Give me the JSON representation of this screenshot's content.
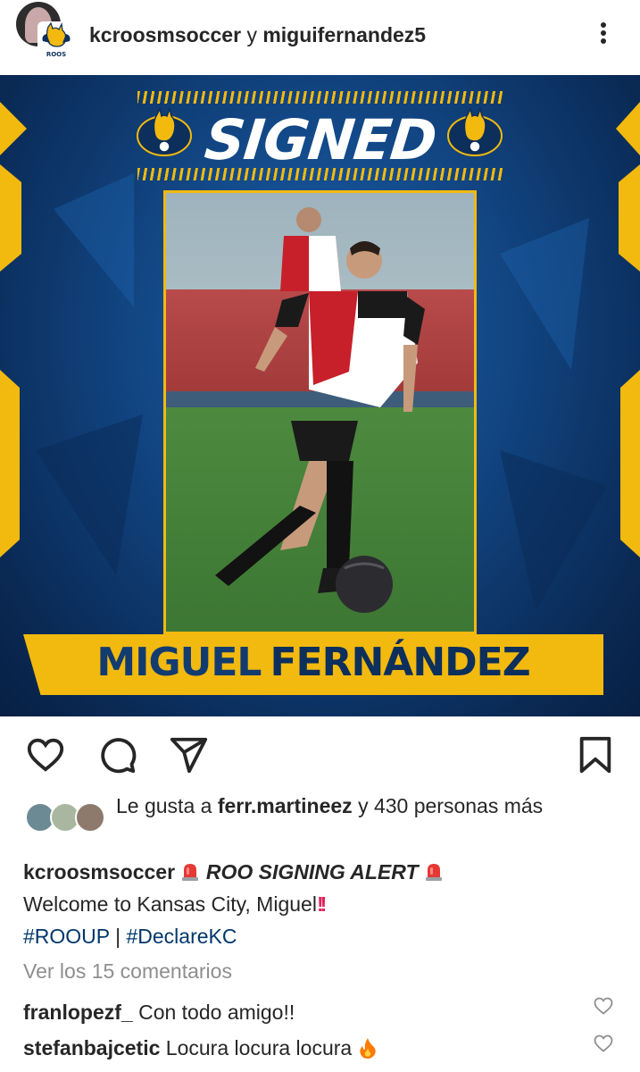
{
  "header": {
    "user1": "kcroosmsoccer",
    "conj": "y",
    "user2": "miguifernandez5",
    "badge_text": "ROOS"
  },
  "post": {
    "headline": "SIGNED",
    "first_name": "MIGUEL",
    "last_name": "FERNÁNDEZ",
    "colors": {
      "accent": "#f2b90f",
      "navy": "#0c2f5c",
      "blue": "#134a8a"
    }
  },
  "actions": {
    "icons": [
      "heart-icon",
      "comment-icon",
      "share-icon",
      "bookmark-icon"
    ]
  },
  "likes": {
    "prefix": "Le gusta a",
    "user": "ferr.martineez",
    "suffix": "y 430 personas más"
  },
  "caption": {
    "user": "kcroosmsoccer",
    "alert": "ROO SIGNING ALERT",
    "line2": "Welcome to Kansas City, Miguel",
    "tag1": "#ROOUP",
    "sep": "|",
    "tag2": "#DeclareKC"
  },
  "view_comments": "Ver los 15 comentarios",
  "comments": [
    {
      "user": "franlopezf_",
      "text": "Con todo amigo!!"
    },
    {
      "user": "stefanbajcetic",
      "text": "Locura locura locura"
    }
  ]
}
